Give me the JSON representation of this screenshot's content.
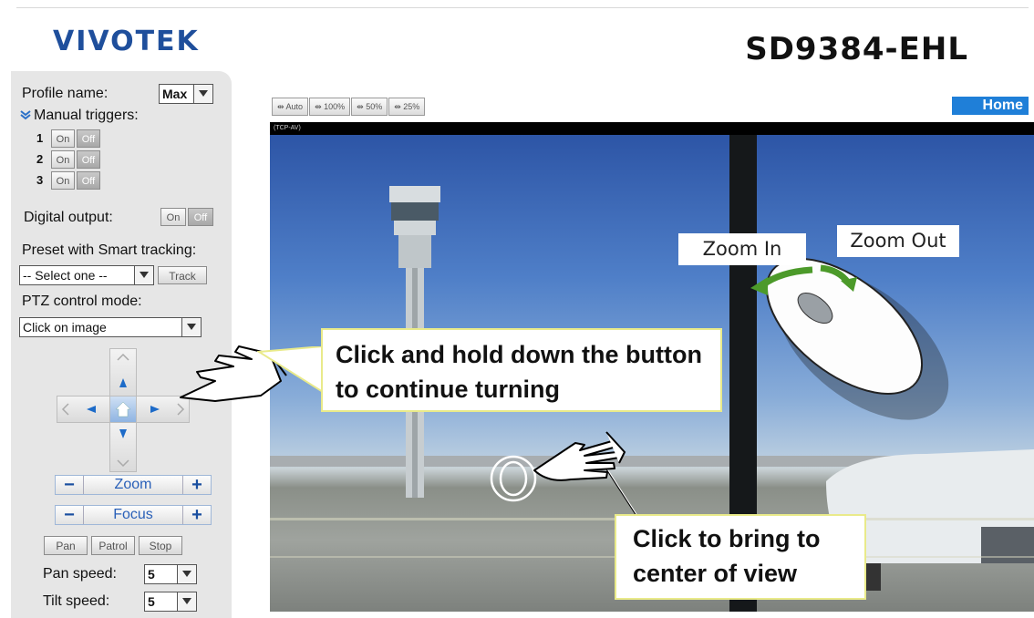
{
  "header": {
    "logo": "VIVOTEK",
    "model": "SD9384-EHL"
  },
  "sidebar": {
    "profile_label": "Profile name:",
    "profile_value": "Max",
    "manual_triggers_label": "Manual triggers:",
    "triggers": [
      {
        "num": "1",
        "on": "On",
        "off": "Off"
      },
      {
        "num": "2",
        "on": "On",
        "off": "Off"
      },
      {
        "num": "3",
        "on": "On",
        "off": "Off"
      }
    ],
    "digital_output_label": "Digital output:",
    "digital_on": "On",
    "digital_off": "Off",
    "preset_label": "Preset with Smart tracking:",
    "preset_value": "-- Select one --",
    "track_label": "Track",
    "ptz_mode_label": "PTZ control mode:",
    "ptz_mode_value": "Click on image",
    "zoom_label": "Zoom",
    "focus_label": "Focus",
    "minus": "−",
    "plus": "+",
    "pan_label": "Pan",
    "patrol_label": "Patrol",
    "stop_label": "Stop",
    "pan_speed_label": "Pan speed:",
    "pan_speed_value": "5",
    "tilt_speed_label": "Tilt speed:",
    "tilt_speed_value": "5"
  },
  "toolbar": {
    "auto": "Auto",
    "p100": "100%",
    "p50": "50%",
    "p25": "25%",
    "home": "Home"
  },
  "video": {
    "stream_label": "(TCP-AV)"
  },
  "annotations": {
    "hold": "Click and hold down the button to continue turning",
    "center": "Click to bring to center of view",
    "zoom_in": "Zoom In",
    "zoom_out": "Zoom Out"
  },
  "colors": {
    "accent": "#1f7fd8",
    "callout_border": "#e9ea8a",
    "logo": "#1f4f9c"
  }
}
